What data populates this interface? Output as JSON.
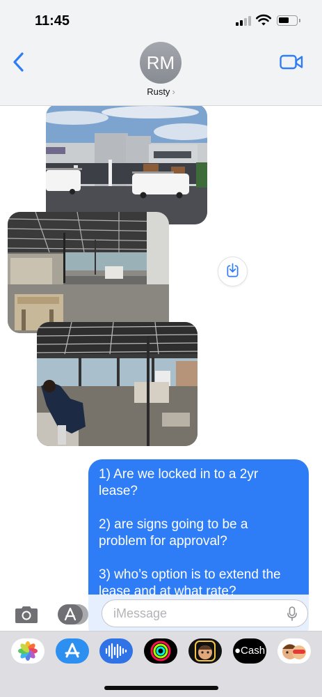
{
  "status_bar": {
    "time": "11:45"
  },
  "header": {
    "avatar_initials": "RM",
    "contact_name": "Rusty"
  },
  "message": {
    "paragraphs": [
      "1) Are we locked in to a 2yr lease?",
      "2) are signs going to be a problem for approval?",
      "3) who’s option is to extend the lease and at what rate?"
    ]
  },
  "compose": {
    "placeholder": "iMessage"
  },
  "drawer": {
    "apps": [
      "photos",
      "app-store",
      "audio",
      "fitness",
      "memoji",
      "apple-cash",
      "memoji-stickers"
    ],
    "cash_label": "Cash"
  },
  "colors": {
    "accent": "#2f7df6",
    "bubble": "#2f7df6",
    "header_bg": "#f2f3f4",
    "drawer_bg": "#dddde2"
  }
}
